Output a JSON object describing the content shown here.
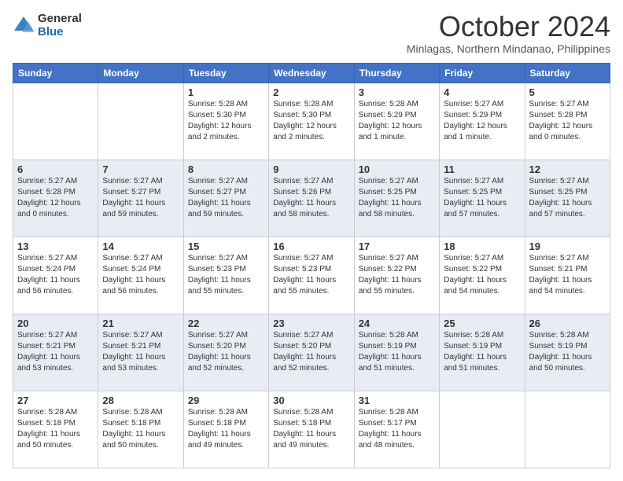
{
  "logo": {
    "general": "General",
    "blue": "Blue"
  },
  "header": {
    "month": "October 2024",
    "subtitle": "Minlagas, Northern Mindanao, Philippines"
  },
  "weekdays": [
    "Sunday",
    "Monday",
    "Tuesday",
    "Wednesday",
    "Thursday",
    "Friday",
    "Saturday"
  ],
  "weeks": [
    [
      {
        "day": "",
        "empty": true
      },
      {
        "day": "",
        "empty": true
      },
      {
        "day": "1",
        "sunrise": "5:28 AM",
        "sunset": "5:30 PM",
        "daylight": "12 hours and 2 minutes."
      },
      {
        "day": "2",
        "sunrise": "5:28 AM",
        "sunset": "5:30 PM",
        "daylight": "12 hours and 2 minutes."
      },
      {
        "day": "3",
        "sunrise": "5:28 AM",
        "sunset": "5:29 PM",
        "daylight": "12 hours and 1 minute."
      },
      {
        "day": "4",
        "sunrise": "5:27 AM",
        "sunset": "5:29 PM",
        "daylight": "12 hours and 1 minute."
      },
      {
        "day": "5",
        "sunrise": "5:27 AM",
        "sunset": "5:28 PM",
        "daylight": "12 hours and 0 minutes."
      }
    ],
    [
      {
        "day": "6",
        "sunrise": "5:27 AM",
        "sunset": "5:28 PM",
        "daylight": "12 hours and 0 minutes."
      },
      {
        "day": "7",
        "sunrise": "5:27 AM",
        "sunset": "5:27 PM",
        "daylight": "11 hours and 59 minutes."
      },
      {
        "day": "8",
        "sunrise": "5:27 AM",
        "sunset": "5:27 PM",
        "daylight": "11 hours and 59 minutes."
      },
      {
        "day": "9",
        "sunrise": "5:27 AM",
        "sunset": "5:26 PM",
        "daylight": "11 hours and 58 minutes."
      },
      {
        "day": "10",
        "sunrise": "5:27 AM",
        "sunset": "5:25 PM",
        "daylight": "11 hours and 58 minutes."
      },
      {
        "day": "11",
        "sunrise": "5:27 AM",
        "sunset": "5:25 PM",
        "daylight": "11 hours and 57 minutes."
      },
      {
        "day": "12",
        "sunrise": "5:27 AM",
        "sunset": "5:25 PM",
        "daylight": "11 hours and 57 minutes."
      }
    ],
    [
      {
        "day": "13",
        "sunrise": "5:27 AM",
        "sunset": "5:24 PM",
        "daylight": "11 hours and 56 minutes."
      },
      {
        "day": "14",
        "sunrise": "5:27 AM",
        "sunset": "5:24 PM",
        "daylight": "11 hours and 56 minutes."
      },
      {
        "day": "15",
        "sunrise": "5:27 AM",
        "sunset": "5:23 PM",
        "daylight": "11 hours and 55 minutes."
      },
      {
        "day": "16",
        "sunrise": "5:27 AM",
        "sunset": "5:23 PM",
        "daylight": "11 hours and 55 minutes."
      },
      {
        "day": "17",
        "sunrise": "5:27 AM",
        "sunset": "5:22 PM",
        "daylight": "11 hours and 55 minutes."
      },
      {
        "day": "18",
        "sunrise": "5:27 AM",
        "sunset": "5:22 PM",
        "daylight": "11 hours and 54 minutes."
      },
      {
        "day": "19",
        "sunrise": "5:27 AM",
        "sunset": "5:21 PM",
        "daylight": "11 hours and 54 minutes."
      }
    ],
    [
      {
        "day": "20",
        "sunrise": "5:27 AM",
        "sunset": "5:21 PM",
        "daylight": "11 hours and 53 minutes."
      },
      {
        "day": "21",
        "sunrise": "5:27 AM",
        "sunset": "5:21 PM",
        "daylight": "11 hours and 53 minutes."
      },
      {
        "day": "22",
        "sunrise": "5:27 AM",
        "sunset": "5:20 PM",
        "daylight": "11 hours and 52 minutes."
      },
      {
        "day": "23",
        "sunrise": "5:27 AM",
        "sunset": "5:20 PM",
        "daylight": "11 hours and 52 minutes."
      },
      {
        "day": "24",
        "sunrise": "5:28 AM",
        "sunset": "5:19 PM",
        "daylight": "11 hours and 51 minutes."
      },
      {
        "day": "25",
        "sunrise": "5:28 AM",
        "sunset": "5:19 PM",
        "daylight": "11 hours and 51 minutes."
      },
      {
        "day": "26",
        "sunrise": "5:28 AM",
        "sunset": "5:19 PM",
        "daylight": "11 hours and 50 minutes."
      }
    ],
    [
      {
        "day": "27",
        "sunrise": "5:28 AM",
        "sunset": "5:18 PM",
        "daylight": "11 hours and 50 minutes."
      },
      {
        "day": "28",
        "sunrise": "5:28 AM",
        "sunset": "5:18 PM",
        "daylight": "11 hours and 50 minutes."
      },
      {
        "day": "29",
        "sunrise": "5:28 AM",
        "sunset": "5:18 PM",
        "daylight": "11 hours and 49 minutes."
      },
      {
        "day": "30",
        "sunrise": "5:28 AM",
        "sunset": "5:18 PM",
        "daylight": "11 hours and 49 minutes."
      },
      {
        "day": "31",
        "sunrise": "5:28 AM",
        "sunset": "5:17 PM",
        "daylight": "11 hours and 48 minutes."
      },
      {
        "day": "",
        "empty": true
      },
      {
        "day": "",
        "empty": true
      }
    ]
  ],
  "labels": {
    "sunrise": "Sunrise:",
    "sunset": "Sunset:",
    "daylight": "Daylight:"
  }
}
